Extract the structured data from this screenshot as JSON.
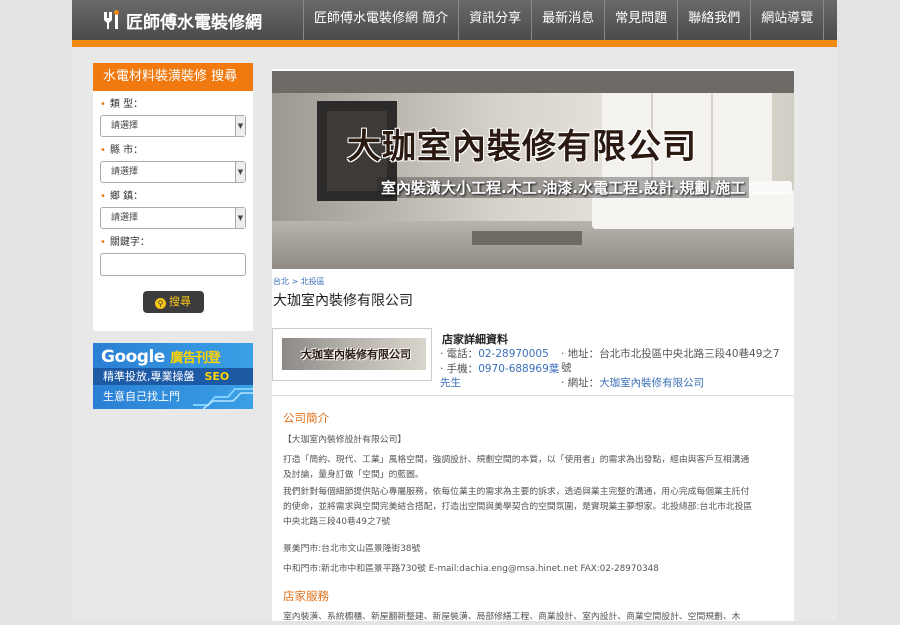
{
  "header": {
    "logo": "匠師傅水電裝修網",
    "nav": [
      "匠師傅水電裝修網 簡介",
      "資訊分享",
      "最新消息",
      "常見問題",
      "聯絡我們",
      "網站導覽"
    ]
  },
  "search": {
    "title": "水電材料裝潢裝修 搜尋",
    "type_label": "類 型：",
    "county_label": "縣 市：",
    "town_label": "鄉 鎮：",
    "keyword_label": "關鍵字：",
    "select_placeholder": "請選擇",
    "button": "搜尋"
  },
  "ad": {
    "line1_a": "Google",
    "line1_b": "廣告刊登",
    "line2_a": "精準投放,專業操盤",
    "line2_b": "SEO",
    "line3": "生意自己找上門"
  },
  "banner": {
    "title": "大珈室內裝修有限公司",
    "subtitle": "室內裝潢大小工程.木工.油漆.水電工程.設計.規劃.施工"
  },
  "breadcrumb": "台北 > 北投區",
  "company": {
    "name": "大珈室內裝修有限公司",
    "card_text": "大珈室內裝修有限公司",
    "detail_title": "店家詳細資料",
    "phone_label": "· 電話：",
    "phone": "02-28970005",
    "mobile_label": "· 手機：",
    "mobile": "0970-688969葉",
    "mobile_cont": "先生",
    "address_label": "· 地址：",
    "address": "台北市北投區中央北路三段40巷49之7",
    "address_cont": "號",
    "site_label": "· 網址：",
    "site": "大珈室內裝修有限公司"
  },
  "intro": {
    "heading": "公司簡介",
    "p1": "【大珈室內裝修設計有限公司】",
    "p2a": "打造「簡約、現代、工業」風格空間，強調設計、規劃空間的本質，以「使用者」的需求為出發點，經由與客戶互相溝通",
    "p2b": "及討論，量身訂做「空間」的藍圖。",
    "p3a": "我們針對每個細節提供貼心專屬服務，依每位業主的需求為主要的訴求，透過與業主完整的溝通，用心完成每個業主託付",
    "p3b": "的使命，並將需求與空間完美結合搭配，打造出空間與美學契合的空間氛圍，是實現業主夢想家。北投總部:台北市北投區",
    "p3c": "中央北路三段40巷49之7號",
    "p4": "景美門市:台北市文山區景隆街38號",
    "p5": "中和門市:新北市中和區景平路730號 E-mail:dachia.eng@msa.hinet.net FAX:02-28970348"
  },
  "services": {
    "heading": "店家服務",
    "text": "室內裝潢、系統櫥櫃、新屋翻新整建、新屋裝潢、局部修繕工程、商業設計、室內設計、商業空間設計、空間規劃、木"
  }
}
